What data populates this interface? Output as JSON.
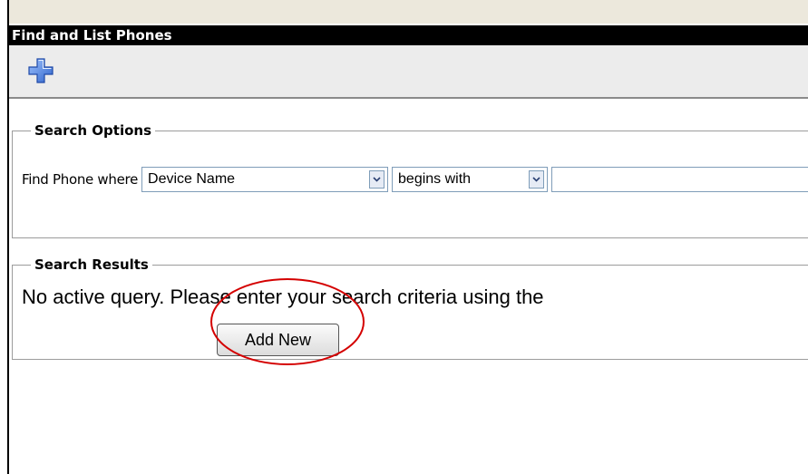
{
  "page": {
    "title": "Find and List Phones"
  },
  "toolbar": {
    "add_icon": "plus-icon"
  },
  "search_options": {
    "legend": "Search Options",
    "find_label": "Find Phone where",
    "field_selected": "Device Name",
    "operator_selected": "begins with",
    "search_value": ""
  },
  "search_results": {
    "legend": "Search Results",
    "message": "No active query. Please enter your search criteria using the",
    "add_new_label": "Add New"
  },
  "annotation": {
    "highlight_color": "#d40000"
  },
  "colors": {
    "title_bar": "#000000",
    "toolbar_bg": "#ececec",
    "icon_blue": "#3b6fd6"
  }
}
